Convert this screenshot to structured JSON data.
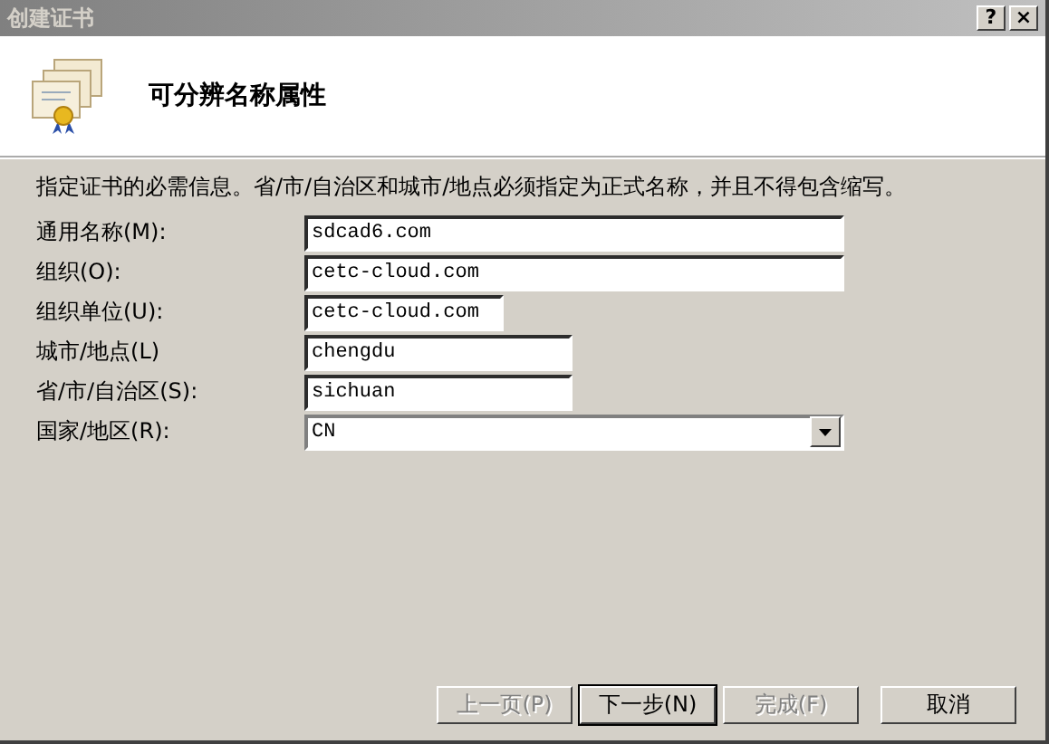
{
  "window": {
    "title": "创建证书",
    "buttons": [
      "?",
      "×"
    ]
  },
  "header": {
    "title": "可分辨名称属性"
  },
  "description": "指定证书的必需信息。省/市/自治区和城市/地点必须指定为正式名称，并且不得包含缩写。",
  "fields": [
    {
      "kind": "input",
      "label": "通用名称(M):",
      "value": "sdcad6.com"
    },
    {
      "kind": "input",
      "label": "组织(O):",
      "value": "cetc-cloud.com"
    },
    {
      "kind": "input",
      "label": "组织单位(U):",
      "value": "cetc-cloud.com"
    },
    {
      "kind": "input",
      "label": "城市/地点(L)",
      "value": "chengdu"
    },
    {
      "kind": "input",
      "label": "省/市/自治区(S):",
      "value": "sichuan"
    },
    {
      "kind": "dropdown",
      "label": "国家/地区(R):",
      "value": "CN"
    }
  ],
  "buttons": [
    {
      "label": "上一页(P)",
      "disabled": true,
      "default": false
    },
    {
      "label": "下一步(N)",
      "disabled": false,
      "default": true
    },
    {
      "label": "完成(F)",
      "disabled": true,
      "default": false
    },
    {
      "label": "取消",
      "disabled": false,
      "default": false
    }
  ]
}
